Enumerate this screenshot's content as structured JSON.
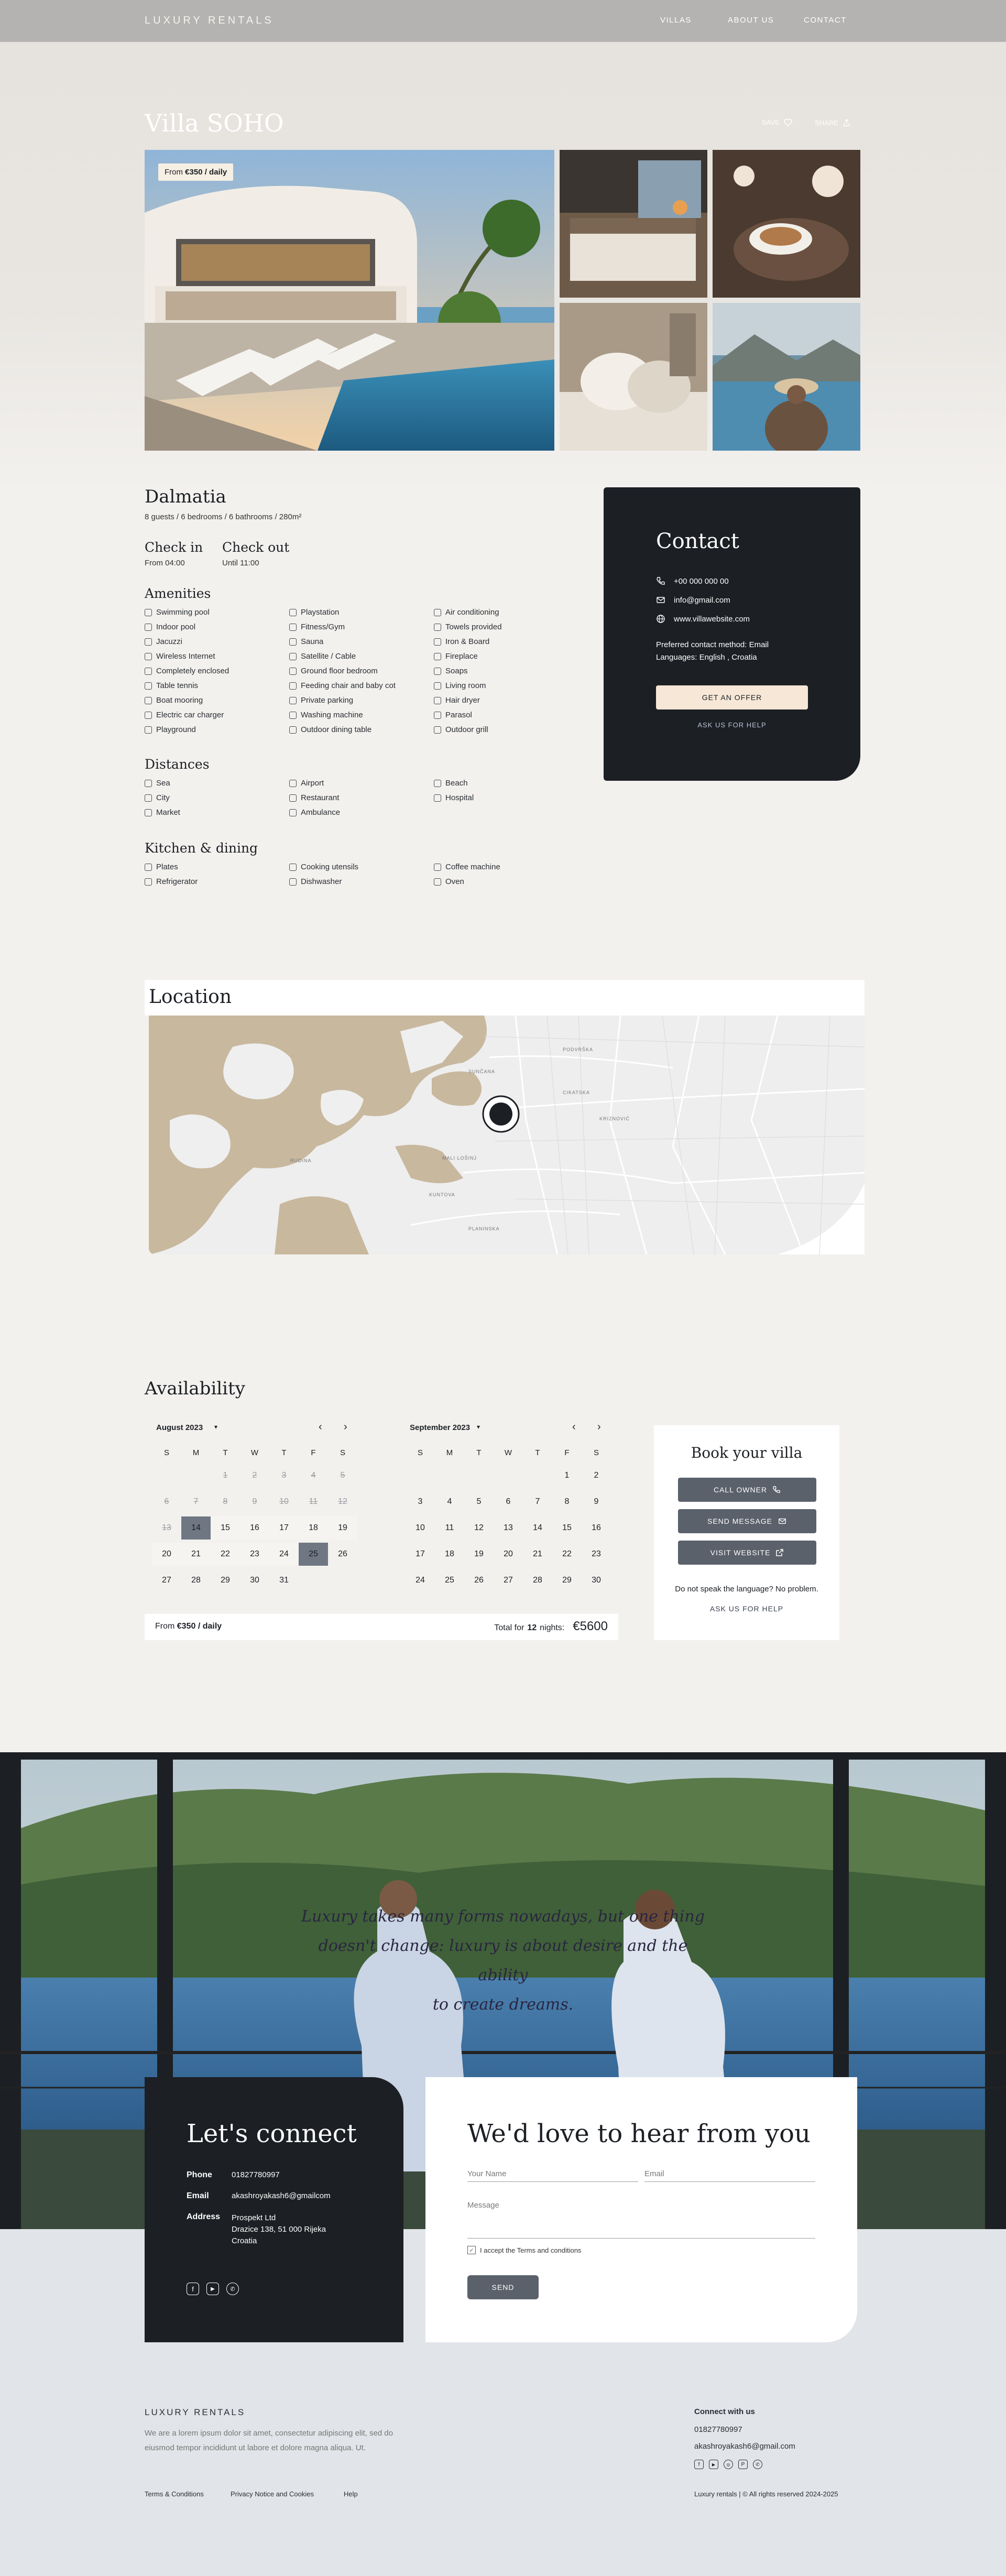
{
  "header": {
    "logo": "LUXURY RENTALS",
    "nav": [
      "VILLAS",
      "ABOUT US",
      "CONTACT"
    ]
  },
  "villa": {
    "title": "Villa SOHO",
    "save_label": "SAVE",
    "share_label": "SHARE",
    "price_tag_prefix": "From ",
    "price_tag_value": "€350 / daily",
    "region": "Dalmatia",
    "specs": "8 guests / 6 bedrooms / 6 bathrooms / 280m²",
    "checkin_label": "Check in",
    "checkin_value": "From 04:00",
    "checkout_label": "Check out",
    "checkout_value": "Until 11:00"
  },
  "amenities": {
    "title": "Amenities",
    "items": [
      {
        "label": "Swimming pool",
        "icon": "pool-icon"
      },
      {
        "label": "Indoor pool",
        "icon": "indoor-pool-icon"
      },
      {
        "label": "Jacuzzi",
        "icon": "jacuzzi-icon"
      },
      {
        "label": "Wireless Internet",
        "icon": "wifi-icon"
      },
      {
        "label": "Completely enclosed",
        "icon": "fence-icon"
      },
      {
        "label": "Table tennis",
        "icon": "table-tennis-icon"
      },
      {
        "label": "Boat mooring",
        "icon": "boat-icon"
      },
      {
        "label": "Electric car charger",
        "icon": "ev-charger-icon"
      },
      {
        "label": "Playground",
        "icon": "playground-icon"
      },
      {
        "label": "Playstation",
        "icon": "gamepad-icon"
      },
      {
        "label": "Fitness/Gym",
        "icon": "dumbbell-icon"
      },
      {
        "label": "Sauna",
        "icon": "sauna-icon"
      },
      {
        "label": "Satellite / Cable",
        "icon": "tv-icon"
      },
      {
        "label": "Ground floor bedroom",
        "icon": "bed-icon"
      },
      {
        "label": "Feeding chair and baby cot",
        "icon": "baby-icon"
      },
      {
        "label": "Private parking",
        "icon": "parking-icon"
      },
      {
        "label": "Washing machine",
        "icon": "washer-icon"
      },
      {
        "label": "Outdoor dining table",
        "icon": "dining-icon"
      },
      {
        "label": "Air conditioning",
        "icon": "ac-icon"
      },
      {
        "label": "Towels provided",
        "icon": "towel-icon"
      },
      {
        "label": "Iron & Board",
        "icon": "iron-icon"
      },
      {
        "label": "Fireplace",
        "icon": "fireplace-icon"
      },
      {
        "label": "Soaps",
        "icon": "soap-icon"
      },
      {
        "label": "Living room",
        "icon": "sofa-icon"
      },
      {
        "label": "Hair dryer",
        "icon": "hair-dryer-icon"
      },
      {
        "label": "Parasol",
        "icon": "parasol-icon"
      },
      {
        "label": "Outdoor grill",
        "icon": "grill-icon"
      }
    ]
  },
  "distances": {
    "title": "Distances",
    "items": [
      {
        "label": "Sea",
        "icon": "sea-icon"
      },
      {
        "label": "City",
        "icon": "city-icon"
      },
      {
        "label": "Market",
        "icon": "market-icon"
      },
      {
        "label": "Airport",
        "icon": "airport-icon"
      },
      {
        "label": "Restaurant",
        "icon": "restaurant-icon"
      },
      {
        "label": "Ambulance",
        "icon": "ambulance-icon"
      },
      {
        "label": "Beach",
        "icon": "beach-icon"
      },
      {
        "label": "Hospital",
        "icon": "hospital-icon"
      }
    ]
  },
  "kitchen": {
    "title": "Kitchen & dining",
    "items": [
      {
        "label": "Plates",
        "icon": "plates-icon"
      },
      {
        "label": "Refrigerator",
        "icon": "fridge-icon"
      },
      {
        "label": "Cooking utensils",
        "icon": "utensils-icon"
      },
      {
        "label": "Dishwasher",
        "icon": "dishwasher-icon"
      },
      {
        "label": "Coffee machine",
        "icon": "coffee-icon"
      },
      {
        "label": "Oven",
        "icon": "oven-icon"
      }
    ]
  },
  "contact": {
    "title": "Contact",
    "phone": "+00 000 000 00",
    "email": "info@gmail.com",
    "website": "www.villawebsite.com",
    "preferred": "Preferred contact method: Email",
    "languages": "Languages: English , Croatia",
    "offer_button": "GET AN OFFER",
    "help_link": "ASK US FOR HELP"
  },
  "location": {
    "title": "Location",
    "map_labels": [
      "PODVRŠKA",
      "CIKATSKA",
      "KRIZNOVIĆ",
      "SUNČANA",
      "RUDINA",
      "MALI LOŠINJ",
      "KUNTOVA",
      "PLANINSKA"
    ]
  },
  "availability": {
    "title": "Availability",
    "dows": [
      "S",
      "M",
      "T",
      "W",
      "T",
      "F",
      "S"
    ],
    "months": [
      {
        "name": "August 2023"
      },
      {
        "name": "September 2023"
      }
    ],
    "footer_prefix": "From ",
    "footer_price": "€350 / daily",
    "total_prefix": "Total for ",
    "total_nights": "12",
    "total_suffix": " nights:",
    "total_value": "€5600"
  },
  "book": {
    "title": "Book your villa",
    "call_button": "CALL OWNER",
    "message_button": "SEND MESSAGE",
    "website_button": "VISIT WEBSITE",
    "language_note": "Do not speak the language? No problem.",
    "help_link": "ASK US FOR HELP"
  },
  "quote": {
    "line1": "Luxury takes many forms nowadays, but one thing",
    "line2": "doesn't change: luxury is about desire and the ability",
    "line3": "to create dreams."
  },
  "connect": {
    "title": "Let's connect",
    "phone_label": "Phone",
    "phone_value": "01827780997",
    "email_label": "Email",
    "email_value": "akashroyakash6@gmailcom",
    "address_label": "Address",
    "address_line1": "Prospekt Ltd",
    "address_line2": "Drazice 138, 51 000 Rijeka",
    "address_line3": "Croatia"
  },
  "form": {
    "title": "We'd love to hear from you",
    "name_placeholder": "Your Name",
    "email_placeholder": "Email",
    "message_placeholder": "Message",
    "terms_label": "I accept the Terms and conditions",
    "send_button": "SEND"
  },
  "footer": {
    "brand": "LUXURY RENTALS",
    "blurb_line1": "We are a lorem ipsum dolor sit amet, consectetur adipiscing elit, sed do",
    "blurb_line2": "eiusmod tempor incididunt ut labore et dolore magna aliqua. Ut.",
    "connect_title": "Connect with us",
    "phone": "01827780997",
    "email": "akashroyakash6@gmail.com",
    "links": [
      "Terms & Conditions",
      "Privacy Notice and Cookies",
      "Help"
    ],
    "copyright": "Luxury rentals | © All rights reserved 2024-2025"
  },
  "colors": {
    "dark": "#1c1f24",
    "accent_cream": "#f6e7d6",
    "button_gray": "#5a616b",
    "page_bg": "#f3f1ee"
  }
}
